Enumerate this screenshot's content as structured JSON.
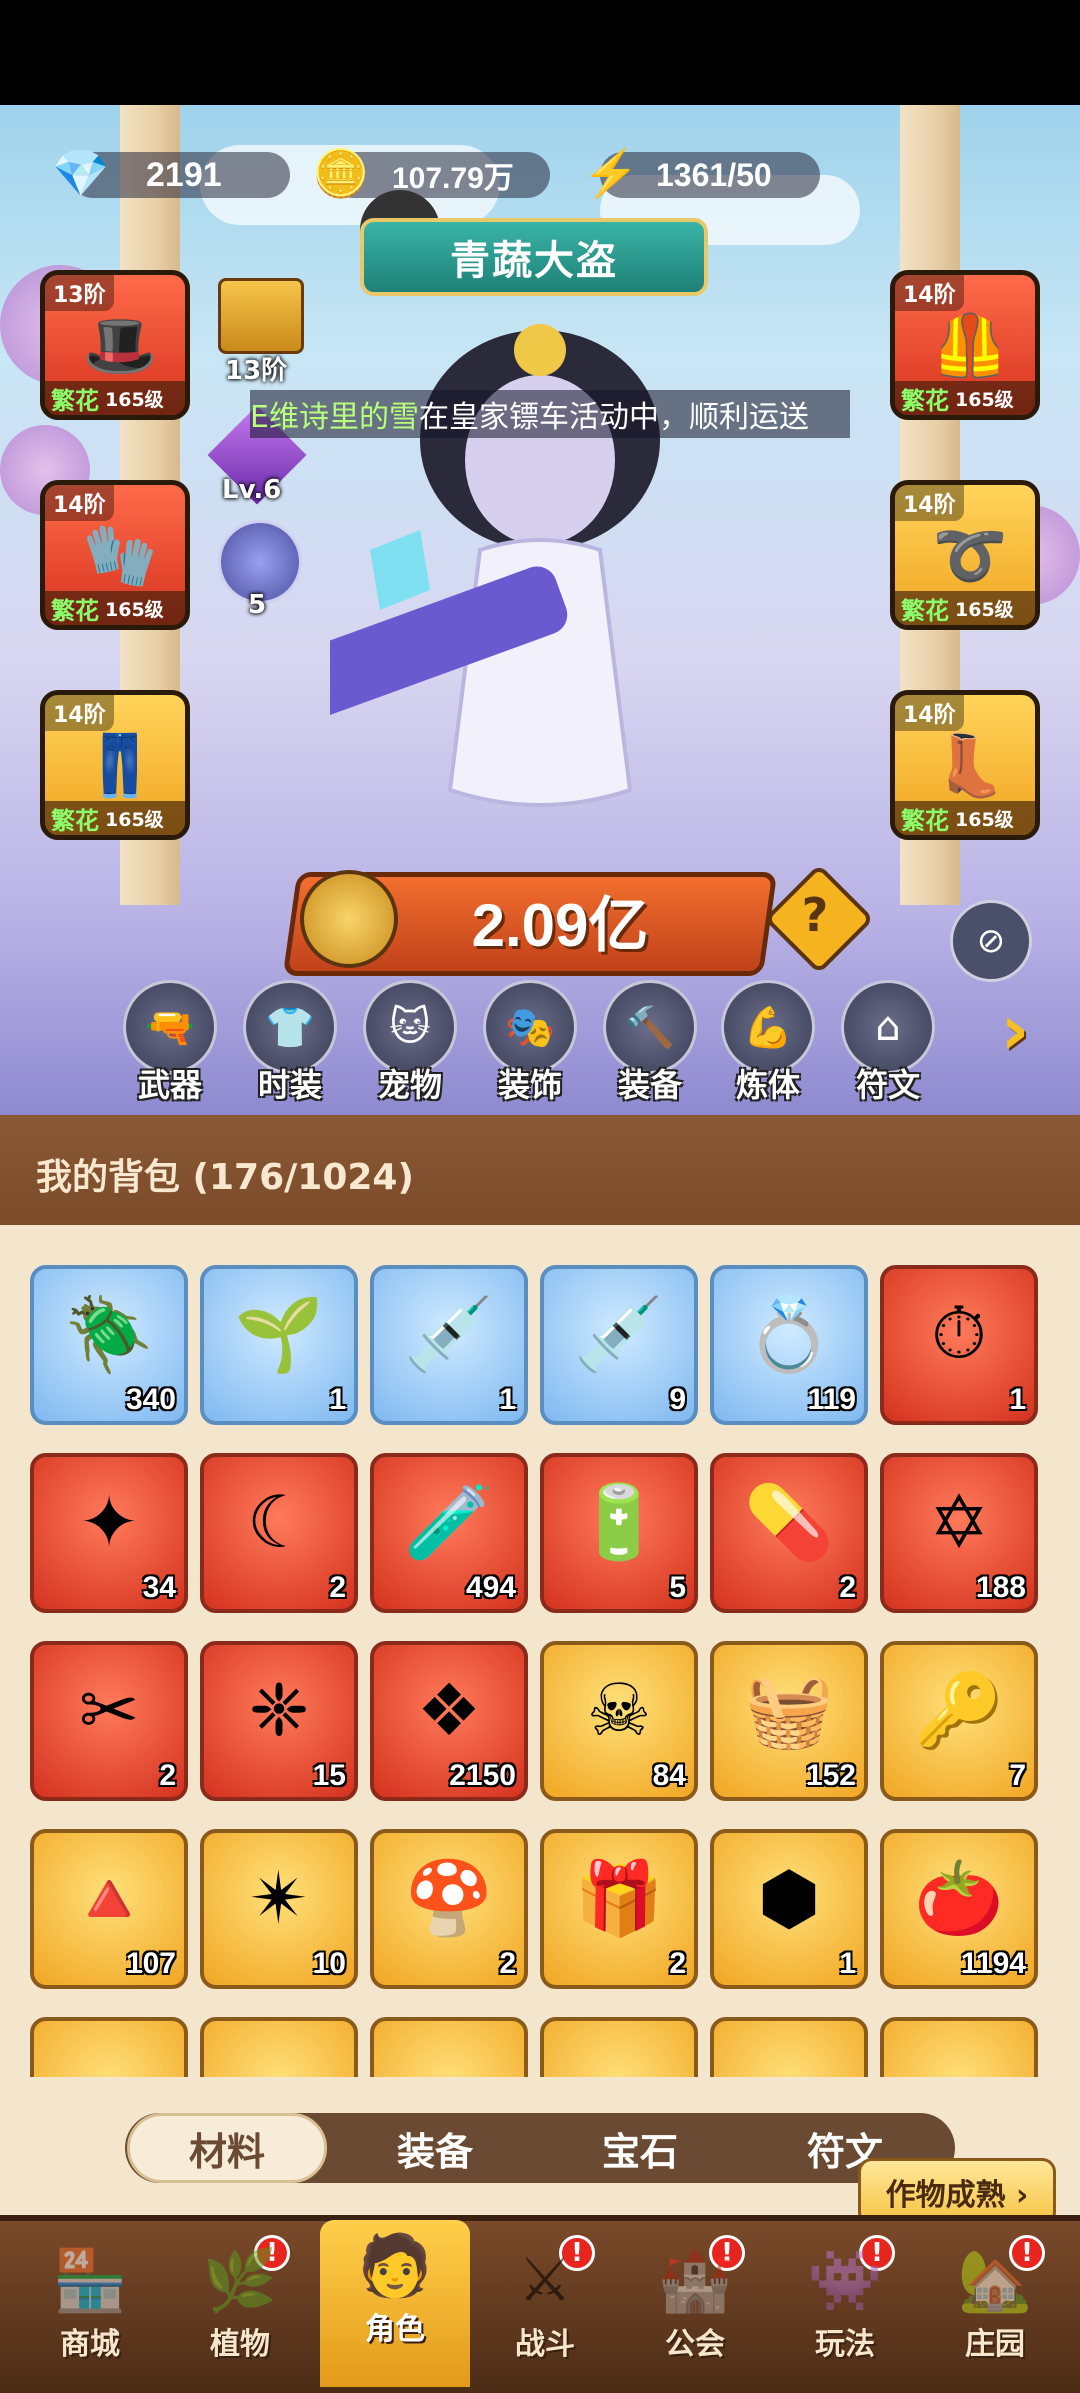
{
  "resources": {
    "diamonds": "2191",
    "gold": "107.79万",
    "energy": "1361/50"
  },
  "title_badge": "青蔬大盗",
  "marquee": {
    "name": "E维诗里的雪",
    "text": "在皇家镖车活动中，顺利运送"
  },
  "equipment_left": [
    {
      "tier": "13阶",
      "type": "繁花",
      "level": "165级",
      "icon": "hat-icon"
    },
    {
      "tier": "14阶",
      "type": "繁花",
      "level": "165级",
      "icon": "glove-icon"
    },
    {
      "tier": "14阶",
      "type": "繁花",
      "level": "165级",
      "icon": "pants-icon"
    }
  ],
  "equipment_right": [
    {
      "tier": "14阶",
      "type": "繁花",
      "level": "165级",
      "icon": "vest-icon"
    },
    {
      "tier": "14阶",
      "type": "繁花",
      "level": "165级",
      "icon": "belt-icon"
    },
    {
      "tier": "14阶",
      "type": "繁花",
      "level": "165级",
      "icon": "boots-icon"
    }
  ],
  "side_stats": {
    "chest_tier": "13阶",
    "gem_level": "Lv.6",
    "orb_count": "5"
  },
  "power": "2.09亿",
  "categories": [
    "武器",
    "时装",
    "宠物",
    "装饰",
    "装备",
    "炼体",
    "符文"
  ],
  "inventory": {
    "title": "我的背包 (176/1024)",
    "items": [
      {
        "count": "340",
        "rarity": "blue",
        "icon": "golden-scarab-icon",
        "glyph": "🪲"
      },
      {
        "count": "1",
        "rarity": "blue",
        "icon": "plant-card-icon",
        "glyph": "🌱"
      },
      {
        "count": "1",
        "rarity": "blue",
        "icon": "syringe-icon",
        "glyph": "💉"
      },
      {
        "count": "9",
        "rarity": "blue",
        "icon": "syringe-cloud-icon",
        "glyph": "💉"
      },
      {
        "count": "119",
        "rarity": "blue",
        "icon": "golden-ring-icon",
        "glyph": "💍"
      },
      {
        "count": "1",
        "rarity": "red",
        "icon": "pocket-watch-card-icon",
        "glyph": "⏱"
      },
      {
        "count": "34",
        "rarity": "red",
        "icon": "star-crystal-icon",
        "glyph": "✦"
      },
      {
        "count": "2",
        "rarity": "red",
        "icon": "moon-star-icon",
        "glyph": "☾"
      },
      {
        "count": "494",
        "rarity": "red",
        "icon": "red-potion-icon",
        "glyph": "🧪"
      },
      {
        "count": "5",
        "rarity": "red",
        "icon": "green-tube-icon",
        "glyph": "🔋"
      },
      {
        "count": "2",
        "rarity": "red",
        "icon": "green-capsule-icon",
        "glyph": "💊"
      },
      {
        "count": "188",
        "rarity": "red",
        "icon": "hexagram-icon",
        "glyph": "✡"
      },
      {
        "count": "2",
        "rarity": "red",
        "icon": "scissors-icon",
        "glyph": "✂"
      },
      {
        "count": "15",
        "rarity": "red",
        "icon": "triquetra-icon",
        "glyph": "❈"
      },
      {
        "count": "2150",
        "rarity": "red",
        "icon": "purple-crystal-icon",
        "glyph": "❖"
      },
      {
        "count": "84",
        "rarity": "gold",
        "icon": "skull-book-icon",
        "glyph": "☠"
      },
      {
        "count": "152",
        "rarity": "gold",
        "icon": "basket-icon",
        "glyph": "🧺"
      },
      {
        "count": "7",
        "rarity": "gold",
        "icon": "ruby-key-icon",
        "glyph": "🔑"
      },
      {
        "count": "107",
        "rarity": "gold",
        "icon": "fire-triangle-icon",
        "glyph": "🔺"
      },
      {
        "count": "10",
        "rarity": "gold",
        "icon": "star-orb-icon",
        "glyph": "✴"
      },
      {
        "count": "2",
        "rarity": "gold",
        "icon": "mushroom-icon",
        "glyph": "🍄"
      },
      {
        "count": "2",
        "rarity": "gold",
        "icon": "gift-book-icon",
        "glyph": "🎁"
      },
      {
        "count": "1",
        "rarity": "gold",
        "icon": "green-cube-icon",
        "glyph": "⬢"
      },
      {
        "count": "1194",
        "rarity": "gold",
        "icon": "tomato-crate-icon",
        "glyph": "🍅"
      },
      {
        "count": "",
        "rarity": "gold",
        "icon": "partial-item-icon",
        "glyph": ""
      },
      {
        "count": "",
        "rarity": "gold",
        "icon": "partial-item-icon",
        "glyph": ""
      },
      {
        "count": "",
        "rarity": "gold",
        "icon": "partial-item-icon",
        "glyph": ""
      },
      {
        "count": "",
        "rarity": "gold",
        "icon": "partial-item-icon",
        "glyph": ""
      },
      {
        "count": "",
        "rarity": "gold",
        "icon": "partial-item-icon",
        "glyph": ""
      },
      {
        "count": "",
        "rarity": "gold",
        "icon": "partial-item-icon",
        "glyph": ""
      }
    ]
  },
  "tabs": [
    "材料",
    "装备",
    "宝石",
    "符文"
  ],
  "active_tab": "材料",
  "crop_tip": "作物成熟 ›",
  "nav": [
    {
      "label": "商城",
      "badge": false
    },
    {
      "label": "植物",
      "badge": true
    },
    {
      "label": "角色",
      "badge": false,
      "active": true
    },
    {
      "label": "战斗",
      "badge": true
    },
    {
      "label": "公会",
      "badge": true
    },
    {
      "label": "玩法",
      "badge": true
    },
    {
      "label": "庄园",
      "badge": true
    }
  ],
  "colors": {
    "rarity_blue": "#7fb8f0",
    "rarity_red": "#d4321e",
    "rarity_gold": "#f1a623",
    "power_banner": "#e05a26",
    "badge_red": "#e7241d"
  }
}
